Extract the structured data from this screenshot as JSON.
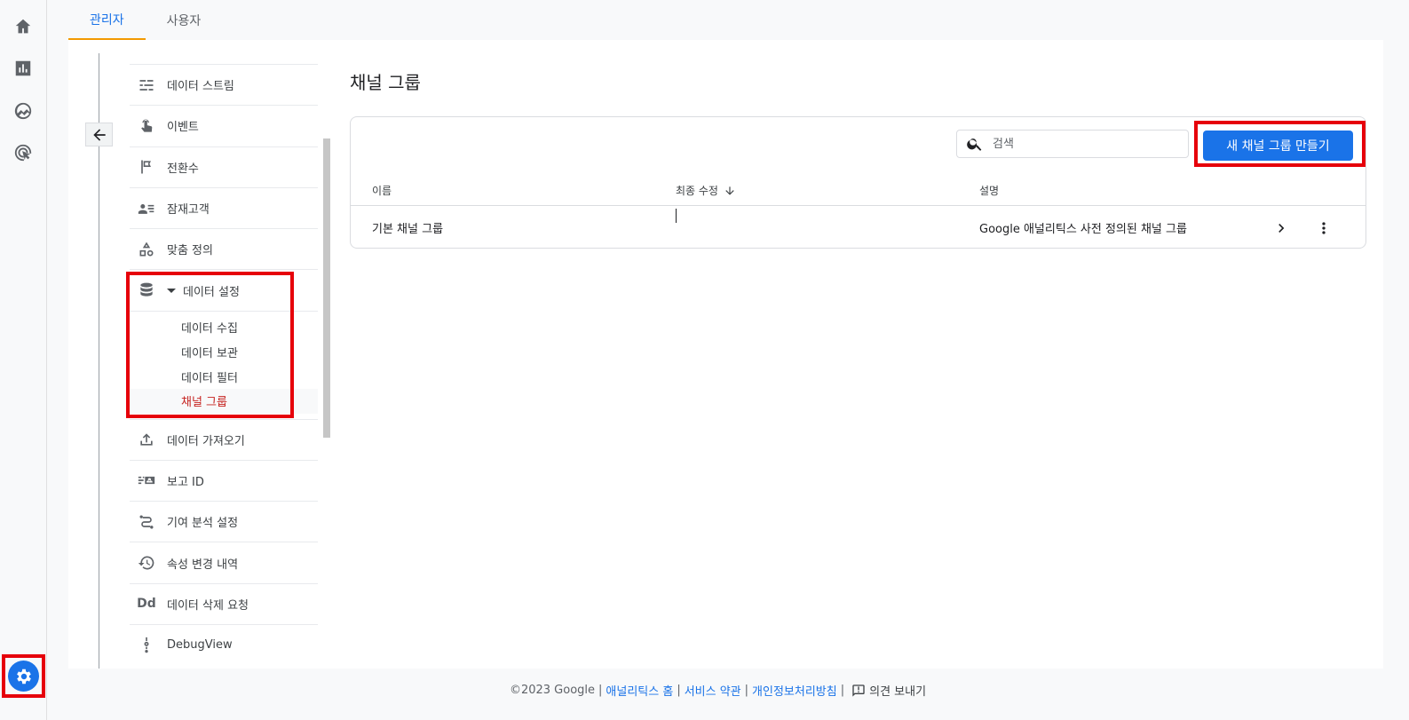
{
  "tabs": [
    {
      "label": "관리자",
      "active": true
    },
    {
      "label": "사용자",
      "active": false
    }
  ],
  "rail": {
    "icons": [
      "home-icon",
      "reports-icon",
      "explore-icon",
      "advertising-icon"
    ],
    "settings_icon": "gear-icon"
  },
  "nav": {
    "items_top": [
      {
        "label": "데이터 스트림",
        "icon": "data-stream-icon"
      },
      {
        "label": "이벤트",
        "icon": "touch-icon"
      },
      {
        "label": "전환수",
        "icon": "flag-icon"
      },
      {
        "label": "잠재고객",
        "icon": "audience-icon"
      },
      {
        "label": "맞춤 정의",
        "icon": "shapes-icon"
      }
    ],
    "data_settings": {
      "label": "데이터 설정",
      "icon": "database-icon",
      "expanded": true,
      "children": [
        {
          "label": "데이터 수집",
          "active": false
        },
        {
          "label": "데이터 보관",
          "active": false
        },
        {
          "label": "데이터 필터",
          "active": false
        },
        {
          "label": "채널 그룹",
          "active": true
        }
      ]
    },
    "items_bottom": [
      {
        "label": "데이터 가져오기",
        "icon": "upload-icon"
      },
      {
        "label": "보고 ID",
        "icon": "report-id-icon"
      },
      {
        "label": "기여 분석 설정",
        "icon": "attribution-icon"
      },
      {
        "label": "속성 변경 내역",
        "icon": "history-icon"
      },
      {
        "label": "데이터 삭제 요청",
        "icon_text": "Dd"
      },
      {
        "label": "DebugView",
        "icon": "debug-icon"
      }
    ]
  },
  "main": {
    "title": "채널 그룹",
    "search_placeholder": "검색",
    "create_button": "새 채널 그룹 만들기",
    "columns": {
      "name": "이름",
      "modified": "최종 수정",
      "description": "설명"
    },
    "rows": [
      {
        "name": "기본 채널 그룹",
        "modified": "",
        "description": "Google 애널리틱스 사전 정의된 채널 그룹"
      }
    ]
  },
  "footer": {
    "copyright": "©2023 Google",
    "links": [
      "애널리틱스 홈",
      "서비스 약관",
      "개인정보처리방침"
    ],
    "feedback": "의견 보내기"
  },
  "colors": {
    "accent": "#1a73e8",
    "active_tab_underline": "#f29900",
    "active_nav": "#c5221f",
    "highlight_box": "#e6000a"
  }
}
